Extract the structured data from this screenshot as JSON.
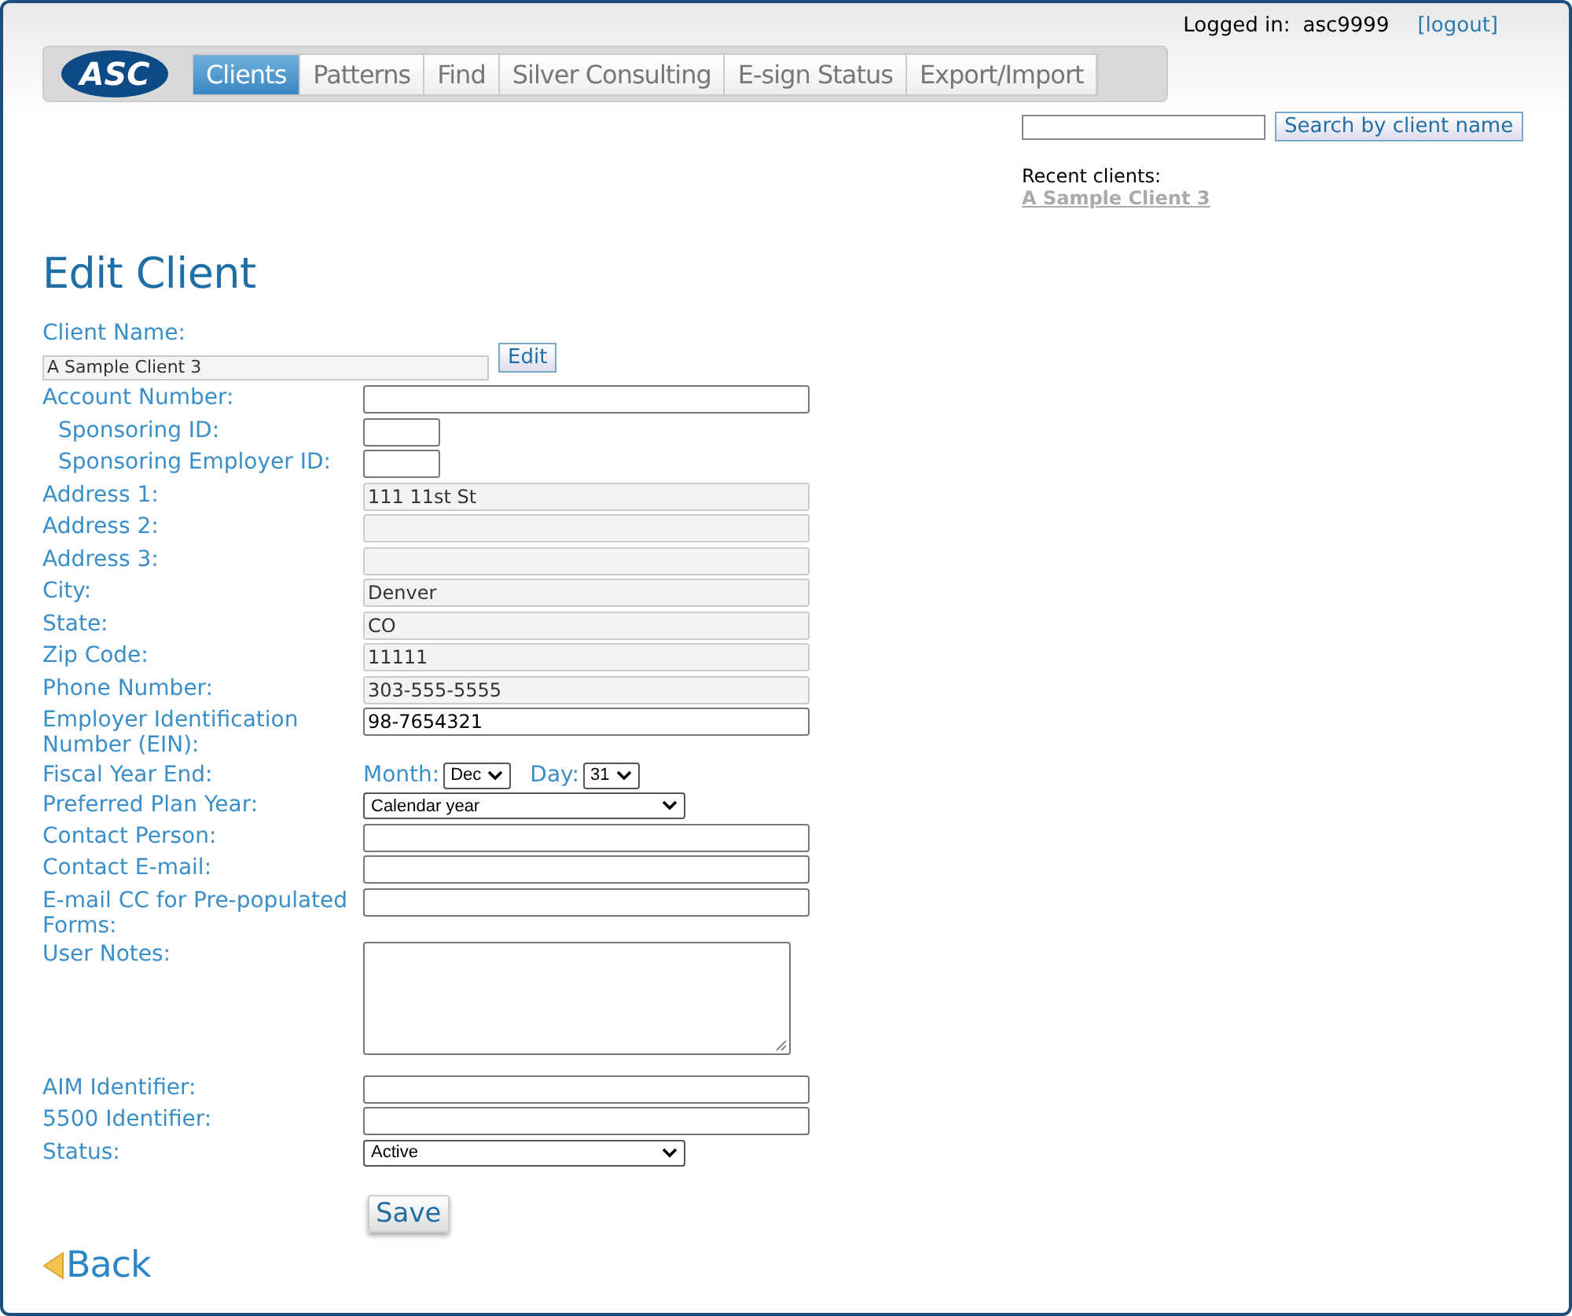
{
  "header": {
    "logged_in_label": "Logged in:",
    "username": "asc9999",
    "logout": "[logout]"
  },
  "logo": "ASC",
  "tabs": [
    {
      "label": "Clients",
      "selected": true
    },
    {
      "label": "Patterns",
      "selected": false
    },
    {
      "label": "Find",
      "selected": false
    },
    {
      "label": "Silver Consulting",
      "selected": false
    },
    {
      "label": "E-sign Status",
      "selected": false
    },
    {
      "label": "Export/Import",
      "selected": false
    }
  ],
  "search": {
    "button": "Search by client name"
  },
  "recent": {
    "label": "Recent clients:",
    "items": [
      "A Sample Client 3"
    ]
  },
  "title": "Edit Client",
  "client_name": {
    "label": "Client Name:",
    "value": "A Sample Client 3",
    "button": "Edit"
  },
  "fields": [
    {
      "kind": "text",
      "label": "Account Number:",
      "children": [
        {
          "kind": "short",
          "label": "Sponsoring ID:"
        },
        {
          "kind": "short",
          "label": "Sponsoring Employer ID:"
        }
      ]
    },
    {
      "kind": "readonly",
      "label": "Address 1:",
      "value": "111 11st St"
    },
    {
      "kind": "readonly",
      "label": "Address 2:"
    },
    {
      "kind": "readonly",
      "label": "Address 3:"
    },
    {
      "kind": "readonly",
      "label": "City:",
      "value": "Denver"
    },
    {
      "kind": "readonly",
      "label": "State:",
      "value": "CO"
    },
    {
      "kind": "readonly",
      "label": "Zip Code:",
      "value": "11111"
    },
    {
      "kind": "readonly",
      "label": "Phone Number:",
      "value": "303-555-5555"
    },
    {
      "kind": "text",
      "label": "Employer Identification Number (EIN):",
      "value": "98-7654321"
    },
    {
      "kind": "date",
      "label": "Fiscal Year End:",
      "month_label": "Month:",
      "month": "Dec",
      "day_label": "Day:",
      "day": "31"
    },
    {
      "kind": "select",
      "label": "Preferred Plan Year:",
      "value": "Calendar year"
    },
    {
      "kind": "text",
      "label": "Contact Person:"
    },
    {
      "kind": "text",
      "label": "Contact E-mail:"
    },
    {
      "kind": "text",
      "label": "E-mail CC for Pre-populated Forms:"
    },
    {
      "kind": "textarea",
      "label": "User Notes:"
    },
    {
      "kind": "text",
      "label": "AIM Identifier:"
    },
    {
      "kind": "text",
      "label": "5500 Identifier:"
    },
    {
      "kind": "select",
      "label": "Status:",
      "value": "Active"
    }
  ],
  "save": "Save",
  "back": "Back"
}
